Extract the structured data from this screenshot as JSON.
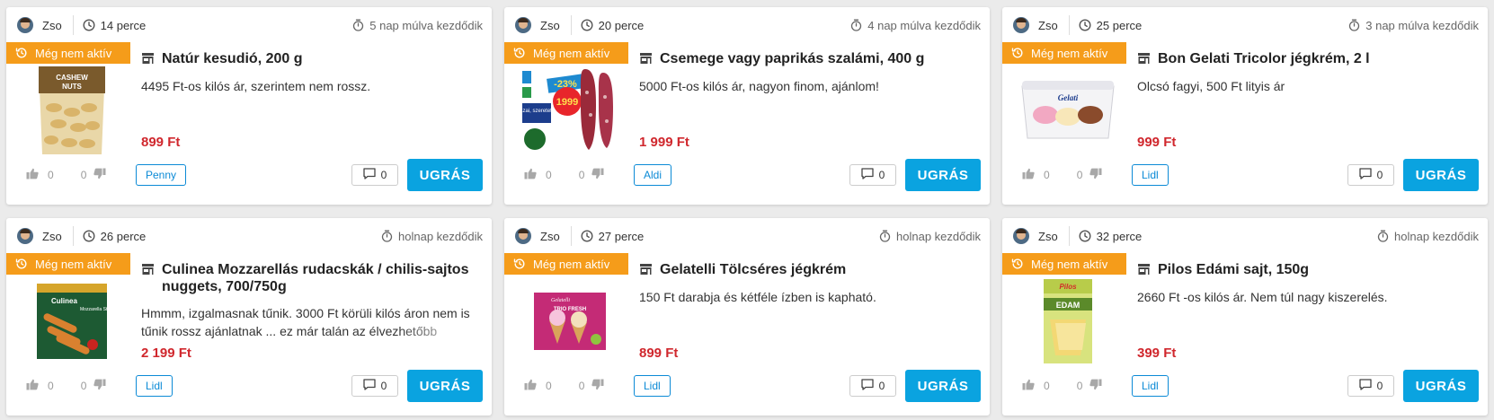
{
  "cards": [
    {
      "user": "Zso",
      "age": "14 perce",
      "starts": "5 nap múlva kezdődik",
      "badge": "Még nem aktív",
      "title": "Natúr kesudió, 200 g",
      "description": "4495 Ft-os kilós ár, szerintem nem rossz.",
      "price": "899 Ft",
      "upvotes": "0",
      "downvotes": "0",
      "store": "Penny",
      "comments": "0",
      "go_label": "UGRÁS",
      "image_text": [
        "CASHEW",
        "NUTS"
      ]
    },
    {
      "user": "Zso",
      "age": "20 perce",
      "starts": "4 nap múlva kezdődik",
      "badge": "Még nem aktív",
      "title": "Csemege vagy paprikás szalámi, 400 g",
      "description": "5000 Ft-os kilós ár, nagyon finom, ajánlom!",
      "price": "1 999 Ft",
      "upvotes": "0",
      "downvotes": "0",
      "store": "Aldi",
      "comments": "0",
      "go_label": "UGRÁS",
      "image_text": [
        "-23%",
        "1999",
        "Hazai, szeretettel"
      ]
    },
    {
      "user": "Zso",
      "age": "25 perce",
      "starts": "3 nap múlva kezdődik",
      "badge": "Még nem aktív",
      "title": "Bon Gelati Tricolor jégkrém, 2 l",
      "description": "Olcsó fagyi, 500 Ft lityis ár",
      "price": "999 Ft",
      "upvotes": "0",
      "downvotes": "0",
      "store": "Lidl",
      "comments": "0",
      "go_label": "UGRÁS",
      "image_text": [
        "Gelati"
      ]
    },
    {
      "user": "Zso",
      "age": "26 perce",
      "starts": "holnap kezdődik",
      "badge": "Még nem aktív",
      "title": "Culinea Mozzarellás rudacskák / chilis-sajtos nuggets, 700/750g",
      "description": "Hmmm, izgalmasnak tűnik. 3000 Ft körüli kilós áron nem is tűnik rossz ajánlatnak ... ez már talán az élvezhetőbb",
      "price": "2 199 Ft",
      "upvotes": "0",
      "downvotes": "0",
      "store": "Lidl",
      "comments": "0",
      "go_label": "UGRÁS",
      "image_text": [
        "Culinea",
        "Mozzarella Sticks"
      ]
    },
    {
      "user": "Zso",
      "age": "27 perce",
      "starts": "holnap kezdődik",
      "badge": "Még nem aktív",
      "title": "Gelatelli Tölcséres jégkrém",
      "description": "150 Ft darabja és kétféle ízben is kapható.",
      "price": "899 Ft",
      "upvotes": "0",
      "downvotes": "0",
      "store": "Lidl",
      "comments": "0",
      "go_label": "UGRÁS",
      "image_text": [
        "Gelatelli",
        "TRIO FRESH"
      ]
    },
    {
      "user": "Zso",
      "age": "32 perce",
      "starts": "holnap kezdődik",
      "badge": "Még nem aktív",
      "title": "Pilos Edámi sajt, 150g",
      "description": "2660 Ft -os kilós ár. Nem túl nagy kiszerelés.",
      "price": "399 Ft",
      "upvotes": "0",
      "downvotes": "0",
      "store": "Lidl",
      "comments": "0",
      "go_label": "UGRÁS",
      "image_text": [
        "Pilos",
        "EDAM"
      ]
    }
  ],
  "colors": {
    "badge": "#f59c1a",
    "price": "#d0272d",
    "go_button": "#0aa3e0",
    "store_tag": "#0b8ad6"
  }
}
